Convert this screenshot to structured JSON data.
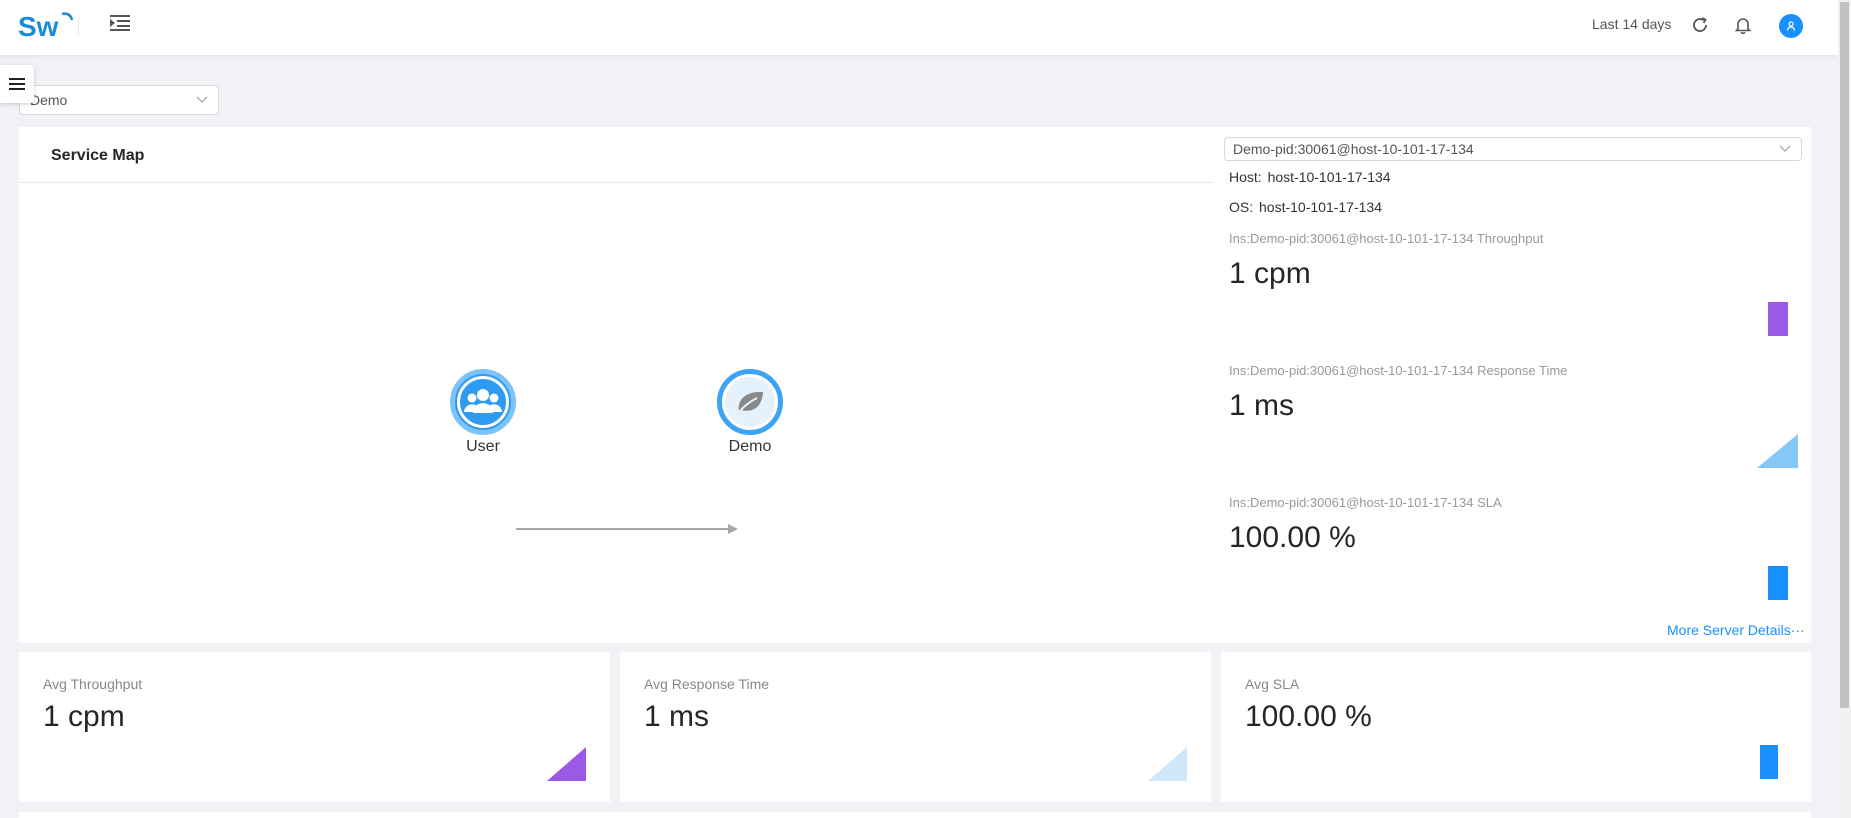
{
  "header": {
    "logo_text": "Sw",
    "time_range": "Last 14 days"
  },
  "service_select": {
    "value": "Demo"
  },
  "service_map": {
    "title": "Service Map",
    "nodes": [
      {
        "label": "User"
      },
      {
        "label": "Demo"
      }
    ]
  },
  "instance": {
    "select_value": "Demo-pid:30061@host-10-101-17-134",
    "host_label": "Host:",
    "host_value": "host-10-101-17-134",
    "os_label": "OS:",
    "os_value": "host-10-101-17-134",
    "metrics": [
      {
        "label": "Ins:Demo-pid:30061@host-10-101-17-134 Throughput",
        "value": "1 cpm",
        "color": "#9b59e5"
      },
      {
        "label": "Ins:Demo-pid:30061@host-10-101-17-134 Response Time",
        "value": "1 ms",
        "color": "#84c8f7"
      },
      {
        "label": "Ins:Demo-pid:30061@host-10-101-17-134 SLA",
        "value": "100.00 %",
        "color": "#1890ff"
      }
    ],
    "more_link": "More Server Details···"
  },
  "stats": [
    {
      "label": "Avg Throughput",
      "value": "1 cpm",
      "color": "#9b59e5"
    },
    {
      "label": "Avg Response Time",
      "value": "1 ms",
      "color": "#cfe7fa"
    },
    {
      "label": "Avg SLA",
      "value": "100.00 %",
      "color": "#1890ff"
    }
  ],
  "colors": {
    "accent": "#1890ff",
    "purple": "#9b59e5",
    "light_blue": "#84c8f7"
  },
  "icons": [
    "menu-fold-icon",
    "reload-icon",
    "bell-icon",
    "user-avatar-icon",
    "hamburger-icon",
    "chevron-down-icon",
    "users-icon",
    "leaf-icon"
  ]
}
